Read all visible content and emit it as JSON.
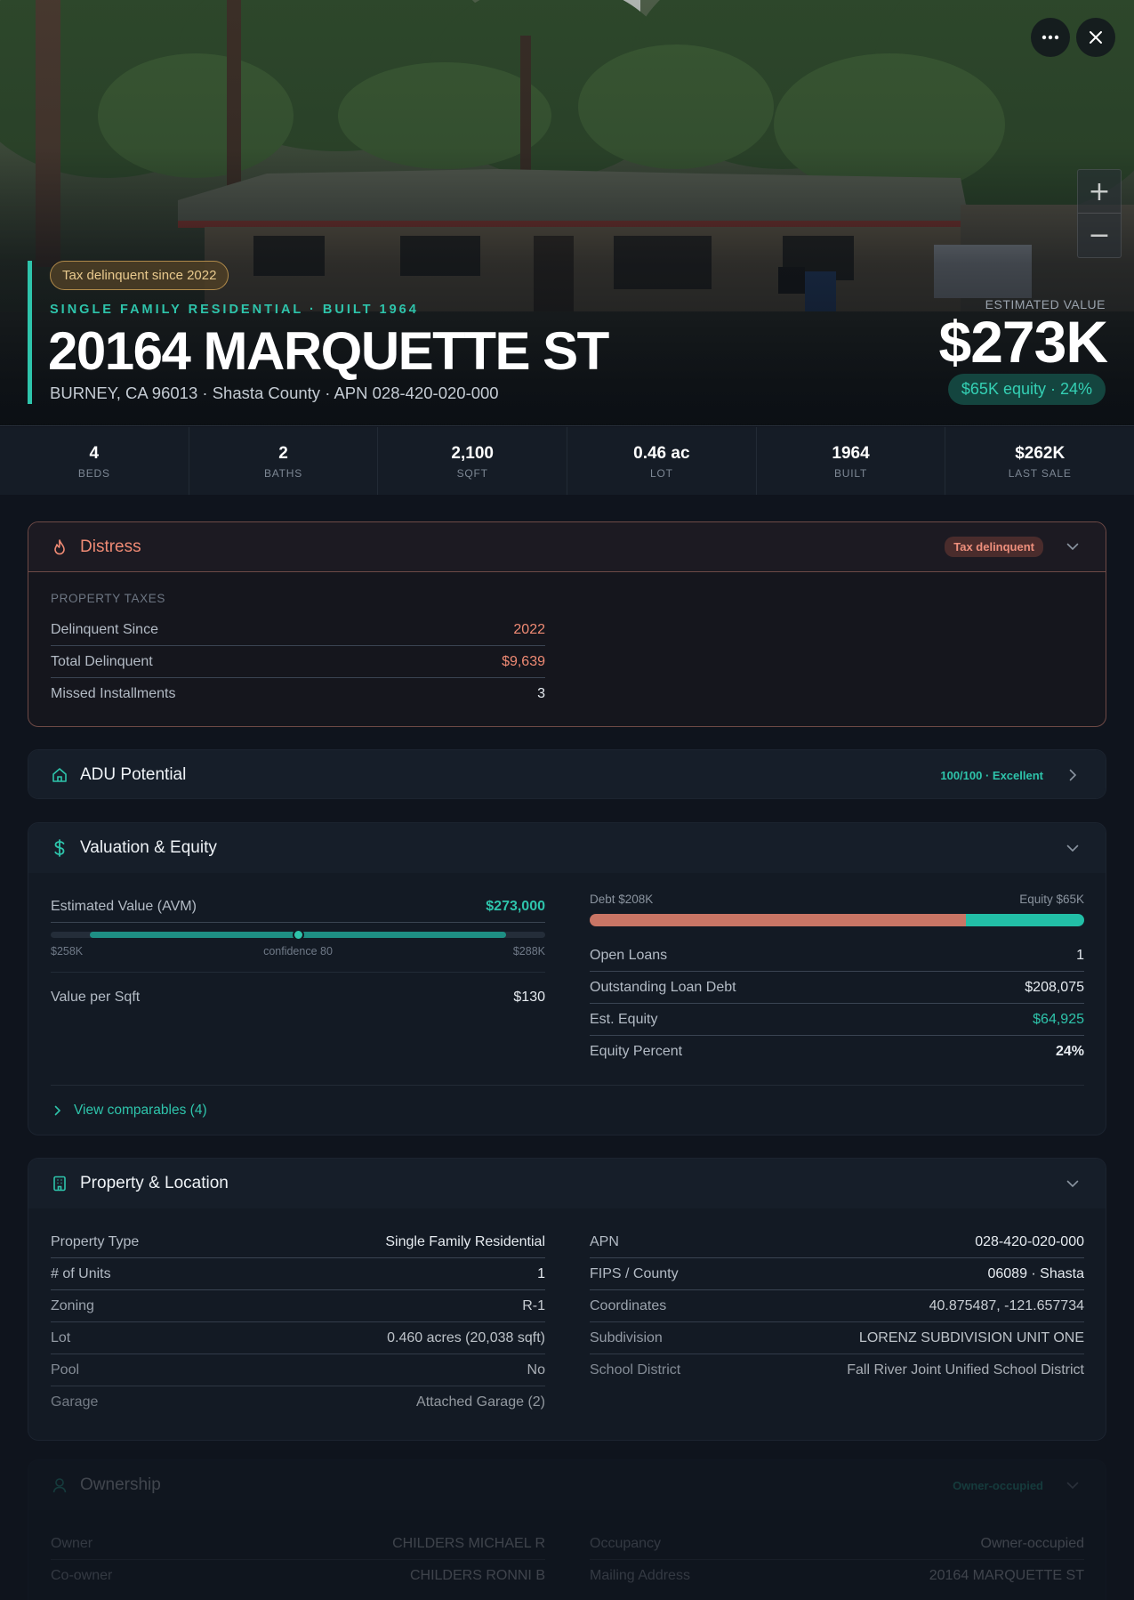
{
  "hero": {
    "tax_badge": "Tax delinquent since 2022",
    "subhead": "SINGLE FAMILY RESIDENTIAL · BUILT 1964",
    "address": "20164 MARQUETTE ST",
    "subaddress": "BURNEY, CA 96013 · Shasta County · APN 028-420-020-000",
    "estimated_value_label": "ESTIMATED VALUE",
    "estimated_value": "$273K",
    "equity_pill": "$65K equity · 24%",
    "zoom_in": "+",
    "zoom_out": "−"
  },
  "stats": [
    {
      "value": "4",
      "label": "BEDS"
    },
    {
      "value": "2",
      "label": "BATHS"
    },
    {
      "value": "2,100",
      "label": "SQFT"
    },
    {
      "value": "0.46 ac",
      "label": "LOT"
    },
    {
      "value": "1964",
      "label": "BUILT"
    },
    {
      "value": "$262K",
      "label": "LAST SALE"
    }
  ],
  "distress": {
    "title": "Distress",
    "badge": "Tax delinquent",
    "section_label": "PROPERTY TAXES",
    "rows": [
      {
        "label": "Delinquent Since",
        "value": "2022"
      },
      {
        "label": "Total Delinquent",
        "value": "$9,639"
      },
      {
        "label": "Missed Installments",
        "value": "3"
      }
    ]
  },
  "adu": {
    "title": "ADU Potential",
    "badge": "100/100 · Excellent"
  },
  "valuation": {
    "title": "Valuation & Equity",
    "avm_label": "Estimated Value (AVM)",
    "avm_value": "$273,000",
    "range_low": "$258K",
    "range_mid": "confidence 80",
    "range_high": "$288K",
    "avm_position": 0.5,
    "range_start": 0.08,
    "range_end": 0.92,
    "per_sqft_label": "Value per Sqft",
    "per_sqft_value": "$130",
    "debt_label": "Debt $208K",
    "equity_label": "Equity $65K",
    "debt_fraction": 0.76,
    "right_rows": [
      {
        "label": "Open Loans",
        "value": "1"
      },
      {
        "label": "Outstanding Loan Debt",
        "value": "$208,075"
      },
      {
        "label": "Est. Equity",
        "value": "$64,925"
      },
      {
        "label": "Equity Percent",
        "value": "24%"
      }
    ],
    "comps_link": "View comparables (4)"
  },
  "property": {
    "title": "Property & Location",
    "left": [
      {
        "label": "Property Type",
        "value": "Single Family Residential"
      },
      {
        "label": "# of Units",
        "value": "1"
      },
      {
        "label": "Zoning",
        "value": "R-1"
      },
      {
        "label": "Lot",
        "value": "0.460 acres (20,038 sqft)"
      },
      {
        "label": "Pool",
        "value": "No"
      },
      {
        "label": "Garage",
        "value": "Attached Garage (2)"
      }
    ],
    "right": [
      {
        "label": "APN",
        "value": "028-420-020-000"
      },
      {
        "label": "FIPS / County",
        "value": "06089 · Shasta"
      },
      {
        "label": "Coordinates",
        "value": "40.875487, -121.657734"
      },
      {
        "label": "Subdivision",
        "value": "LORENZ SUBDIVISION UNIT ONE"
      },
      {
        "label": "School District",
        "value": "Fall River Joint Unified School District"
      }
    ]
  },
  "ownership": {
    "title": "Ownership",
    "badge": "Owner-occupied",
    "left": [
      {
        "label": "Owner",
        "value": "CHILDERS MICHAEL R"
      },
      {
        "label": "Co-owner",
        "value": "CHILDERS RONNI B"
      }
    ],
    "right": [
      {
        "label": "Occupancy",
        "value": "Owner-occupied"
      },
      {
        "label": "Mailing Address",
        "value": "20164 MARQUETTE ST"
      }
    ]
  },
  "colors": {
    "accent": "#2ec4ab",
    "distress": "#ef8a74",
    "debt": "#c97565",
    "equity": "#22bfa7",
    "tax_badge": "#e8c98d"
  },
  "icons": [
    "more-icon",
    "close-icon",
    "flame-icon",
    "home-icon",
    "dollar-icon",
    "building-icon",
    "user-icon",
    "chevron-down-icon",
    "chevron-right-icon"
  ]
}
